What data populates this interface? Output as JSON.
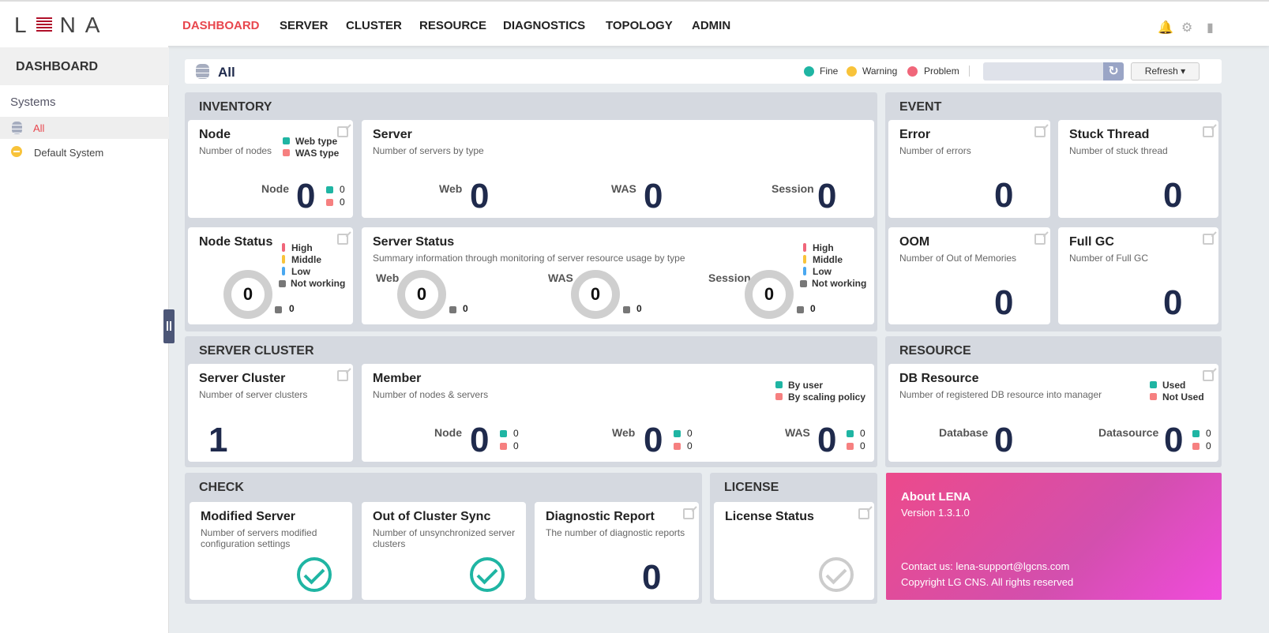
{
  "header": {
    "logo": "LENA",
    "nav": [
      {
        "label": "DASHBOARD",
        "active": true
      },
      {
        "label": "SERVER"
      },
      {
        "label": "CLUSTER"
      },
      {
        "label": "RESOURCE"
      },
      {
        "label": "DIAGNOSTICS"
      },
      {
        "label": "TOPOLOGY"
      },
      {
        "label": "ADMIN"
      }
    ],
    "icons": [
      "bell-icon",
      "gear-icon",
      "logout-icon"
    ]
  },
  "sidebar": {
    "title": "DASHBOARD",
    "section": "Systems",
    "items": [
      {
        "label": "All",
        "icon": "database-icon",
        "selected": true
      },
      {
        "label": "Default System",
        "icon": "warning-icon"
      }
    ]
  },
  "topbar": {
    "title": "All",
    "legend": [
      "Fine",
      "Warning",
      "Problem"
    ],
    "refresh_label": "Refresh",
    "search_value": ""
  },
  "colors": {
    "accent": "#e8464d",
    "web": "#1fb5a3",
    "was": "#f68080",
    "high": "#f0667a",
    "middle": "#f8c33a",
    "low": "#4aa8f0",
    "not_working": "#777777",
    "navy": "#1f2a4c"
  },
  "inventory": {
    "title": "INVENTORY",
    "node": {
      "title": "Node",
      "subtitle": "Number of nodes",
      "legend": [
        "Web type",
        "WAS type"
      ],
      "label": "Node",
      "value": "0",
      "web": "0",
      "was": "0"
    },
    "server": {
      "title": "Server",
      "subtitle": "Number of servers by type",
      "items": [
        {
          "label": "Web",
          "value": "0"
        },
        {
          "label": "WAS",
          "value": "0"
        },
        {
          "label": "Session",
          "value": "0"
        }
      ]
    },
    "node_status": {
      "title": "Node Status",
      "legend": [
        "High",
        "Middle",
        "Low",
        "Not working"
      ],
      "value": "0",
      "not_working": "0"
    },
    "server_status": {
      "title": "Server Status",
      "subtitle": "Summary information through monitoring of server resource usage by type",
      "legend": [
        "High",
        "Middle",
        "Low",
        "Not working"
      ],
      "items": [
        {
          "label": "Web",
          "value": "0",
          "not_working": "0"
        },
        {
          "label": "WAS",
          "value": "0",
          "not_working": "0"
        },
        {
          "label": "Session",
          "value": "0",
          "not_working": "0"
        }
      ]
    }
  },
  "event": {
    "title": "EVENT",
    "cards": [
      {
        "title": "Error",
        "subtitle": "Number of errors",
        "value": "0"
      },
      {
        "title": "Stuck Thread",
        "subtitle": "Number of stuck thread",
        "value": "0"
      },
      {
        "title": "OOM",
        "subtitle": "Number of Out of Memories",
        "value": "0"
      },
      {
        "title": "Full GC",
        "subtitle": "Number of Full GC",
        "value": "0"
      }
    ]
  },
  "cluster": {
    "title": "SERVER CLUSTER",
    "server_cluster": {
      "title": "Server Cluster",
      "subtitle": "Number of server clusters",
      "value": "1"
    },
    "member": {
      "title": "Member",
      "subtitle": "Number of nodes & servers",
      "legend": [
        "By user",
        "By scaling policy"
      ],
      "items": [
        {
          "label": "Node",
          "value": "0",
          "a": "0",
          "b": "0"
        },
        {
          "label": "Web",
          "value": "0",
          "a": "0",
          "b": "0"
        },
        {
          "label": "WAS",
          "value": "0",
          "a": "0",
          "b": "0"
        }
      ]
    }
  },
  "resource": {
    "title": "RESOURCE",
    "db": {
      "title": "DB Resource",
      "subtitle": "Number of registered DB resource into manager",
      "legend": [
        "Used",
        "Not Used"
      ],
      "database_label": "Database",
      "database": "0",
      "datasource_label": "Datasource",
      "datasource": "0",
      "used": "0",
      "not_used": "0"
    }
  },
  "check": {
    "title": "CHECK",
    "cards": [
      {
        "title": "Modified Server",
        "subtitle": "Number of servers modified configuration settings",
        "status": "ok"
      },
      {
        "title": "Out of Cluster Sync",
        "subtitle": "Number of unsynchronized server clusters",
        "status": "ok"
      },
      {
        "title": "Diagnostic Report",
        "subtitle": "The number of diagnostic reports",
        "value": "0"
      }
    ]
  },
  "license": {
    "title": "LICENSE",
    "card_title": "License Status",
    "status": "inactive"
  },
  "about": {
    "title": "About LENA",
    "version": "Version 1.3.1.0",
    "contact": "Contact us: lena-support@lgcns.com",
    "copyright": "Copyright LG CNS. All rights reserved"
  }
}
